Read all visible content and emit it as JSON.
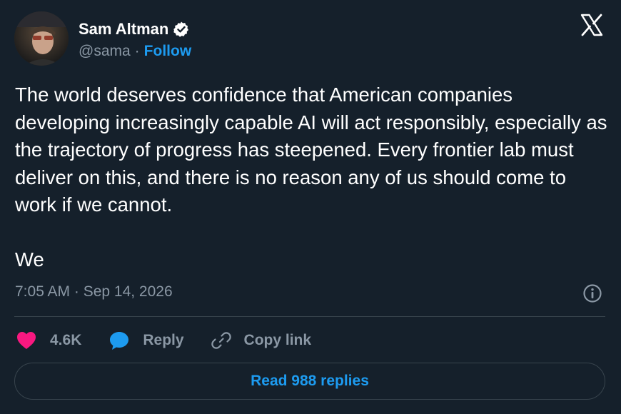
{
  "author": {
    "name": "Sam Altman",
    "handle": "@sama",
    "separator": "·",
    "follow_label": "Follow"
  },
  "tweet": {
    "text": "The world deserves confidence that American companies developing increasingly capable AI will act responsibly, especially as the trajectory of progress has steepened. Every frontier lab must deliver on this, and there is no reason any of us should come to work if we cannot.\n\nWe",
    "timestamp": "7:05 AM · Sep 14, 2026"
  },
  "actions": {
    "like_count": "4.6K",
    "reply_label": "Reply",
    "copy_link_label": "Copy link"
  },
  "footer": {
    "read_replies_label": "Read 988 replies"
  },
  "colors": {
    "background": "#15202b",
    "accent": "#1d9bf0",
    "like": "#f91880",
    "secondary_text": "#8b98a5",
    "border": "#38444d"
  },
  "icons": {
    "verified": "verified-badge-icon",
    "platform": "x-logo-icon",
    "info": "info-icon",
    "like": "heart-icon",
    "reply": "speech-bubble-icon",
    "copy_link": "link-icon"
  }
}
